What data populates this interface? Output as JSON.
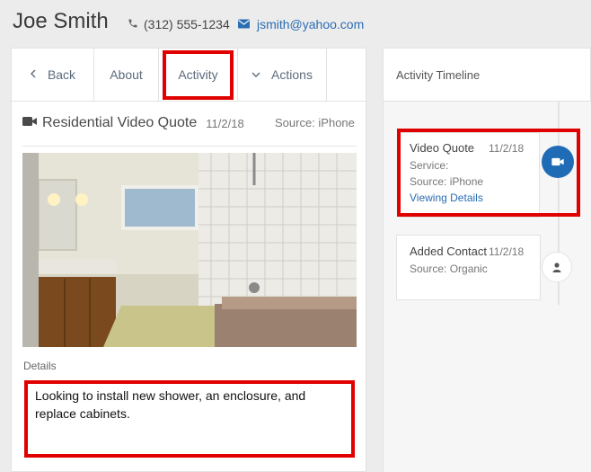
{
  "contact": {
    "name": "Joe Smith",
    "phone": "(312) 555-1234",
    "email": "jsmith@yahoo.com"
  },
  "tabs": {
    "back": "Back",
    "about": "About",
    "activity": "Activity",
    "actions": "Actions"
  },
  "activity": {
    "title": "Residential Video Quote",
    "date": "11/2/18",
    "source": "Source: iPhone",
    "details_label": "Details",
    "details_text": "Looking to install new shower, an enclosure, and replace cabinets."
  },
  "timeline": {
    "header": "Activity Timeline",
    "items": [
      {
        "title": "Video Quote",
        "date": "11/2/18",
        "service": "Service:",
        "source": "Source: iPhone",
        "link": "Viewing Details",
        "icon": "video-camera-icon"
      },
      {
        "title": "Added Contact",
        "date": "11/2/18",
        "source": "Source: Organic",
        "icon": "person-icon"
      }
    ]
  },
  "colors": {
    "accent": "#1f6bb5",
    "link": "#2a6db3",
    "highlight": "#e00000"
  },
  "icons": {
    "phone": "phone-icon",
    "email": "envelope-icon",
    "back": "chevron-left-icon",
    "actions": "chevron-down-icon",
    "quote": "video-camera-icon"
  }
}
